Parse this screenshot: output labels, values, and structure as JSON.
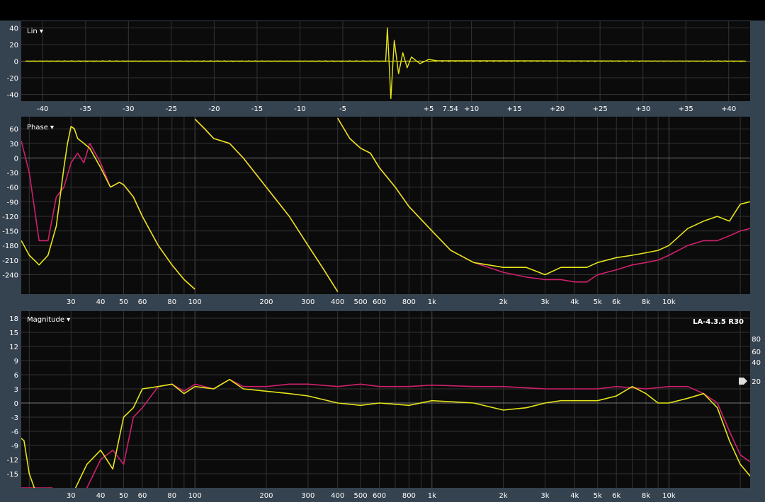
{
  "colors": {
    "bg_frame": "#35424f",
    "plot_bg": "#0b0b0b",
    "grid": "#4a4a4a",
    "text": "#ffffff",
    "yellow": "#e5e51a",
    "magenta": "#d0206e"
  },
  "panels": {
    "impulse": {
      "label": "Lin ▾"
    },
    "phase": {
      "label": "Phase ▾"
    },
    "magnitude": {
      "label": "Magnitude ▾",
      "badge": "LA-4.3.5 R30"
    }
  },
  "chart_data": [
    {
      "type": "line",
      "title": "Lin",
      "yticks": [
        "40",
        "20",
        "0",
        "-20",
        "-40"
      ],
      "ylim": [
        -48,
        48
      ],
      "xticks": [
        "-40",
        "-35",
        "-30",
        "-25",
        "-20",
        "-15",
        "-10",
        "-5",
        "7.54",
        "+5",
        "+10",
        "+15",
        "+20",
        "+25",
        "+30",
        "+35",
        "+40"
      ],
      "xlim": [
        -42.5,
        42.5
      ],
      "series": [
        {
          "color": "yellow",
          "x": [
            -42,
            0,
            0.2,
            0.6,
            1,
            1.5,
            2,
            2.5,
            3,
            4,
            5,
            6,
            42
          ],
          "y": [
            0,
            0,
            40,
            -45,
            25,
            -15,
            10,
            -8,
            5,
            -3,
            2,
            0.5,
            0
          ]
        }
      ]
    },
    {
      "type": "line",
      "title": "Phase",
      "yticks": [
        "60",
        "30",
        "0",
        "-30",
        "-60",
        "-90",
        "-120",
        "-150",
        "-180",
        "-210",
        "-240"
      ],
      "ylim": [
        -280,
        85
      ],
      "xscale": "log",
      "xticks": [
        "30",
        "40",
        "50",
        "60",
        "80",
        "100",
        "200",
        "300",
        "400",
        "500",
        "600",
        "800",
        "1k",
        "2k",
        "3k",
        "4k",
        "5k",
        "6k",
        "8k",
        "10k"
      ],
      "xlim": [
        18.5,
        22000
      ],
      "series": [
        {
          "color": "magenta",
          "segments": [
            {
              "x": [
                18.5,
                20,
                22,
                24,
                26,
                28,
                30,
                32,
                34,
                36,
                40,
                44,
                48,
                50,
                55,
                60,
                70,
                80,
                90,
                100
              ],
              "y": [
                35,
                -30,
                -170,
                -170,
                -80,
                -60,
                -10,
                10,
                -10,
                30,
                -10,
                -60,
                -50,
                -55,
                -80,
                -120,
                -180,
                -220,
                -250,
                -270
              ]
            },
            {
              "x": [
                100,
                120,
                140,
                160,
                200,
                250,
                300,
                350,
                400
              ],
              "y": [
                80,
                40,
                30,
                0,
                -60,
                -120,
                -180,
                -230,
                -275
              ]
            },
            {
              "x": [
                400,
                450,
                500,
                550,
                600,
                700,
                800,
                1000,
                1200,
                1500,
                2000,
                2500,
                3000,
                3500,
                4000,
                4500,
                5000,
                6000,
                7000,
                8000,
                9000,
                10000,
                12000,
                14000,
                16000,
                18000,
                20000,
                22000
              ],
              "y": [
                82,
                40,
                20,
                10,
                -20,
                -60,
                -100,
                -150,
                -190,
                -215,
                -235,
                -245,
                -250,
                -250,
                -255,
                -255,
                -240,
                -230,
                -220,
                -215,
                -210,
                -200,
                -180,
                -170,
                -170,
                -160,
                -150,
                -145
              ]
            }
          ]
        },
        {
          "color": "yellow",
          "segments": [
            {
              "x": [
                18.5,
                19,
                20,
                21,
                22,
                24,
                26,
                28,
                29,
                30,
                31,
                32,
                34,
                36,
                40,
                44,
                48,
                50,
                55,
                60,
                70,
                80,
                90,
                100
              ],
              "y": [
                -170,
                -180,
                -200,
                -210,
                -220,
                -200,
                -140,
                -20,
                30,
                65,
                60,
                40,
                30,
                20,
                -20,
                -60,
                -50,
                -55,
                -80,
                -120,
                -180,
                -220,
                -250,
                -270
              ]
            },
            {
              "x": [
                100,
                110,
                120,
                140,
                160,
                200,
                250,
                300,
                350,
                400
              ],
              "y": [
                80,
                60,
                40,
                30,
                0,
                -60,
                -120,
                -180,
                -230,
                -275
              ]
            },
            {
              "x": [
                400,
                450,
                500,
                550,
                600,
                700,
                800,
                1000,
                1200,
                1500,
                2000,
                2500,
                3000,
                3500,
                4000,
                4500,
                5000,
                6000,
                7000,
                8000,
                9000,
                10000,
                12000,
                14000,
                16000,
                18000,
                20000,
                22000
              ],
              "y": [
                82,
                40,
                20,
                10,
                -20,
                -60,
                -100,
                -150,
                -190,
                -215,
                -225,
                -225,
                -240,
                -225,
                -225,
                -225,
                -215,
                -205,
                -200,
                -195,
                -190,
                -180,
                -145,
                -130,
                -120,
                -130,
                -95,
                -90
              ]
            }
          ]
        }
      ]
    },
    {
      "type": "line",
      "title": "Magnitude",
      "yticks": [
        "18",
        "15",
        "12",
        "9",
        "6",
        "3",
        "0",
        "-3",
        "-6",
        "-9",
        "-12",
        "-15"
      ],
      "ylim": [
        -18,
        19.5
      ],
      "y2ticks": [
        "80",
        "60",
        "40",
        "20"
      ],
      "xscale": "log",
      "xticks": [
        "30",
        "40",
        "50",
        "60",
        "80",
        "100",
        "200",
        "300",
        "400",
        "500",
        "600",
        "800",
        "1k",
        "2k",
        "3k",
        "4k",
        "5k",
        "6k",
        "8k",
        "10k"
      ],
      "xlim": [
        18.5,
        22000
      ],
      "series": [
        {
          "color": "magenta",
          "x": [
            18.5,
            22,
            25,
            30,
            35,
            40,
            45,
            50,
            55,
            60,
            70,
            80,
            90,
            100,
            120,
            140,
            160,
            200,
            250,
            300,
            400,
            500,
            600,
            800,
            1000,
            1500,
            2000,
            3000,
            4000,
            5000,
            6000,
            8000,
            10000,
            12000,
            14000,
            16000,
            18000,
            20000,
            22000
          ],
          "y": [
            -18,
            -18,
            -18,
            -22,
            -18,
            -12,
            -10,
            -13,
            -3,
            -1,
            3.5,
            4,
            2.5,
            4,
            3,
            5,
            3.5,
            3.5,
            4,
            4,
            3.5,
            4,
            3.5,
            3.5,
            3.8,
            3.5,
            3.5,
            3,
            3,
            3,
            3.5,
            3,
            3.5,
            3.5,
            2,
            0,
            -6,
            -11,
            -12.5
          ]
        },
        {
          "color": "yellow",
          "x": [
            18.5,
            19,
            20,
            21,
            22,
            25,
            30,
            35,
            40,
            45,
            50,
            55,
            60,
            70,
            80,
            90,
            100,
            120,
            140,
            160,
            200,
            250,
            300,
            400,
            500,
            600,
            800,
            1000,
            1500,
            2000,
            2500,
            3000,
            3500,
            4000,
            5000,
            6000,
            7000,
            8000,
            9000,
            10000,
            12000,
            14000,
            16000,
            18000,
            20000,
            22000
          ],
          "y": [
            -7.5,
            -8,
            -15,
            -18,
            -20,
            -25,
            -20,
            -13,
            -10,
            -14,
            -3,
            -1,
            3,
            3.5,
            4,
            2,
            3.5,
            3,
            5,
            3,
            2.5,
            2,
            1.5,
            0,
            -0.5,
            0,
            -0.5,
            0.5,
            0,
            -1.5,
            -1,
            0,
            0.5,
            0.5,
            0.5,
            1.5,
            3.5,
            2,
            0,
            0,
            1,
            2,
            -1,
            -8,
            -13,
            -15.5
          ]
        }
      ]
    }
  ]
}
